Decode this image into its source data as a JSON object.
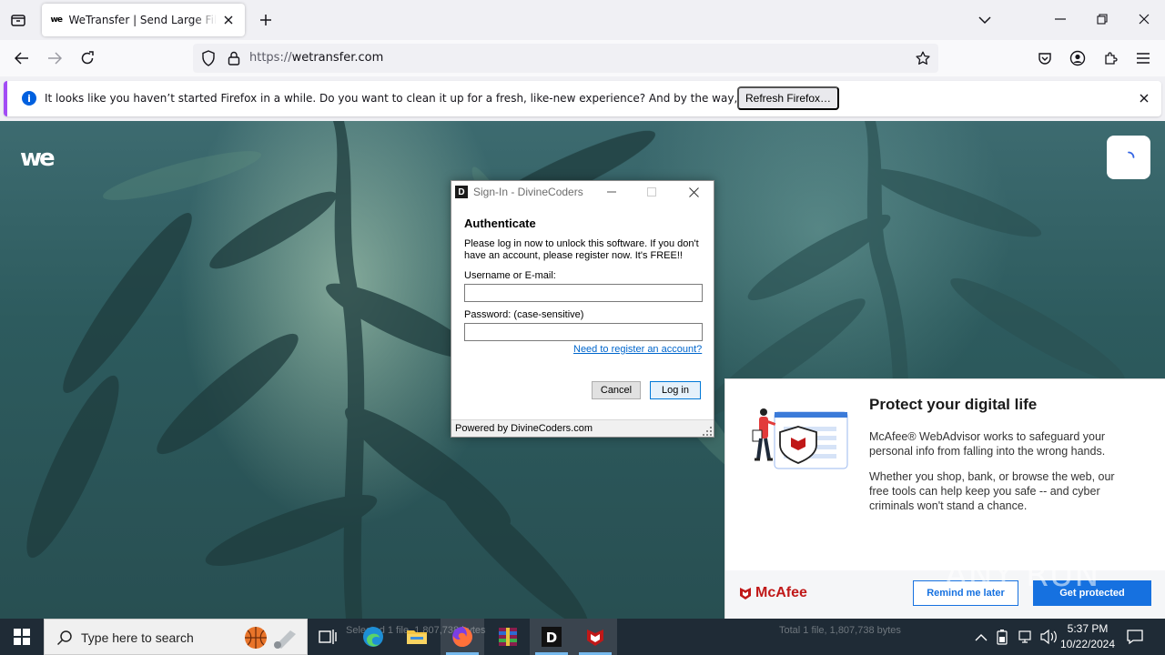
{
  "browser": {
    "tab": {
      "title": "WeTransfer | Send Large Files Fast",
      "favicon": "we"
    },
    "url": {
      "scheme": "https://",
      "host": "wetransfer.com"
    }
  },
  "notification": {
    "message": "It looks like you haven’t started Firefox in a while. Do you want to clean it up for a fresh, like-new experience? And by the way, welcome back!",
    "button": "Refresh Firefox…"
  },
  "page": {
    "logo": "we"
  },
  "dialog": {
    "icon": "D",
    "title": "Sign-In - DivineCoders",
    "heading": "Authenticate",
    "description": "Please log in now to unlock this software. If you don't have an account, please register now. It's FREE!!",
    "username_label": "Username or E-mail:",
    "username_value": "",
    "password_label": "Password: (case-sensitive)",
    "password_value": "",
    "register_link": "Need to register an account?",
    "cancel": "Cancel",
    "login": "Log in",
    "footer": "Powered by DivineCoders.com"
  },
  "mcafee": {
    "title": "Protect your digital life",
    "p1": "McAfee® WebAdvisor works to safeguard your personal info from falling into the wrong hands.",
    "p2": "Whether you shop, bank, or browse the web, our free tools can help keep you safe -- and cyber criminals won't stand a chance.",
    "logo": "McAfee",
    "remind": "Remind me later",
    "protect": "Get protected",
    "brand_color": "#c01818",
    "button_color": "#1671e0"
  },
  "watermark": "ANY RUN",
  "taskbar": {
    "search_placeholder": "Type here to search",
    "ghost_left": "Selected 1 file, 1,807,738 bytes",
    "ghost_right": "Total 1 file, 1,807,738 bytes",
    "time": "5:37 PM",
    "date": "10/22/2024"
  }
}
